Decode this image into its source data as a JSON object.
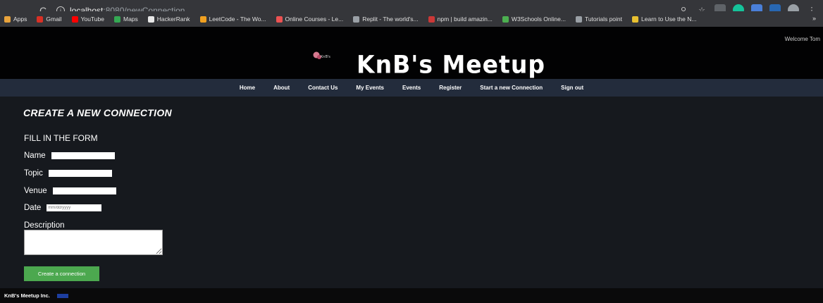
{
  "browser": {
    "url_host": "localhost",
    "url_path": ":8080/newConnection",
    "bookmarks": [
      {
        "label": "Apps",
        "color": "#e8a33c"
      },
      {
        "label": "Gmail",
        "color": "#d93025"
      },
      {
        "label": "YouTube",
        "color": "#ff0000"
      },
      {
        "label": "Maps",
        "color": "#34a853"
      },
      {
        "label": "HackerRank",
        "color": "#e8e8e8"
      },
      {
        "label": "LeetCode - The Wo...",
        "color": "#f0a020"
      },
      {
        "label": "Online Courses - Le...",
        "color": "#ec5252"
      },
      {
        "label": "Replit - The world's...",
        "color": "#9aa0a6"
      },
      {
        "label": "npm | build amazin...",
        "color": "#cb3837"
      },
      {
        "label": "W3Schools Online...",
        "color": "#4caf50"
      },
      {
        "label": "Tutorials point",
        "color": "#9aa0a6"
      },
      {
        "label": "Learn to Use the N...",
        "color": "#e8c030"
      }
    ],
    "more": "»"
  },
  "header": {
    "welcome": "Welcome Tom",
    "logo_text": "KnB's",
    "title": "KnB's Meetup"
  },
  "nav": {
    "items": [
      "Home",
      "About",
      "Contact Us",
      "My Events",
      "Events",
      "Register",
      "Start a new Connection",
      "Sign out"
    ]
  },
  "main": {
    "heading": "CREATE A NEW CONNECTION",
    "subheading": "FILL IN THE FORM",
    "name_label": "Name",
    "topic_label": "Topic",
    "venue_label": "Venue",
    "date_label": "Date",
    "date_placeholder": "mm/dd/yyyy",
    "description_label": "Description",
    "submit_label": "Create a connection"
  },
  "footer": {
    "text": "KnB's Meetup Inc."
  }
}
